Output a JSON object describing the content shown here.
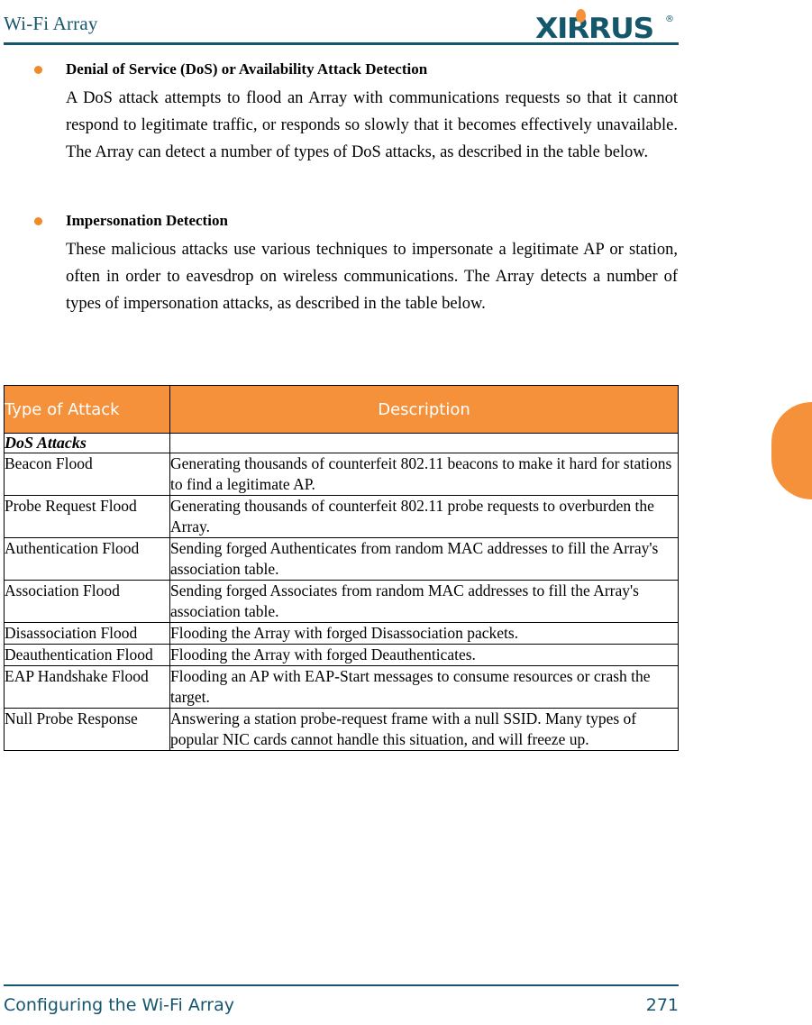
{
  "header": {
    "title": "Wi-Fi Array",
    "logo": {
      "wordmark": "XIRRUS",
      "trademark": "®",
      "dot_icon": "orange-dot-icon",
      "brand_color": "#14576B",
      "accent_color": "#F6913B"
    }
  },
  "content": {
    "bullets": [
      {
        "heading": "Denial of Service (DoS) or Availability Attack Detection",
        "paragraph": "A DoS attack attempts to flood an Array with communications requests so that it cannot respond to legitimate traffic, or responds so slowly that it becomes effectively unavailable. The Array can detect a number of types of DoS attacks, as described in the table below."
      },
      {
        "heading": "Impersonation Detection",
        "paragraph": "These malicious attacks use various techniques to impersonate a legitimate AP or station, often in order to eavesdrop on wireless communications. The Array detects a number of types of impersonation attacks, as described in the table below."
      }
    ]
  },
  "table": {
    "columns": [
      "Type of Attack",
      "Description"
    ],
    "header_bg": "#F6913B",
    "header_text_color": "#FFFFFF",
    "groups": [
      {
        "label": "DoS Attacks",
        "rows": [
          {
            "type": "Beacon Flood",
            "description": "Generating thousands of counterfeit 802.11 beacons to make it hard for stations to find a legitimate AP."
          },
          {
            "type": "Probe Request Flood",
            "description": "Generating thousands of counterfeit 802.11 probe requests to overburden the Array."
          },
          {
            "type": "Authentication Flood",
            "description": "Sending forged Authenticates from random MAC addresses to fill the Array's association table."
          },
          {
            "type": "Association Flood",
            "description": "Sending forged Associates from random MAC addresses to fill the Array's association table."
          },
          {
            "type": "Disassociation Flood",
            "description": "Flooding the Array with forged Disassociation packets."
          },
          {
            "type": "Deauthentication Flood",
            "description": "Flooding the Array with forged Deauthenticates."
          },
          {
            "type": "EAP Handshake Flood",
            "description": "Flooding an AP with EAP-Start messages to consume resources or crash the target."
          },
          {
            "type": "Null Probe Response",
            "description": "Answering a station probe-request frame with a null SSID. Many types of popular NIC cards cannot handle this situation, and will freeze up."
          }
        ]
      }
    ]
  },
  "side_tab": {
    "name": "chapter-thumb-tab",
    "color": "#F6913B"
  },
  "footer": {
    "label": "Configuring the Wi-Fi Array",
    "page_number": "271",
    "color": "#15556E"
  }
}
